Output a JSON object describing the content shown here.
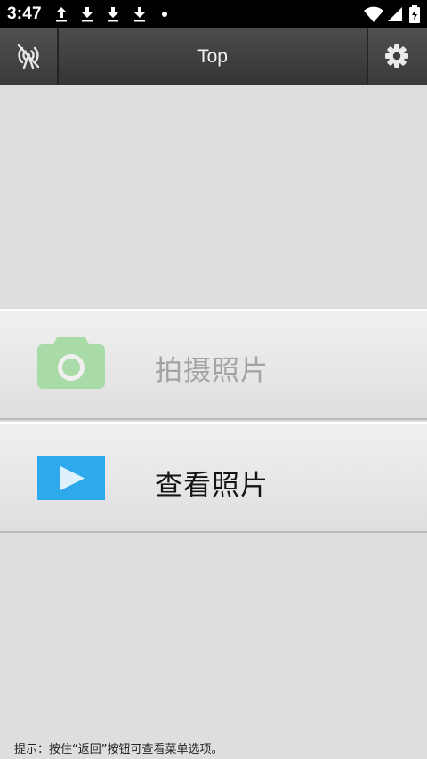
{
  "status_bar": {
    "time": "3:47",
    "icons": [
      "upload-icon",
      "download-icon",
      "download-icon",
      "download-icon",
      "notification-dot-icon",
      "wifi-icon",
      "signal-icon",
      "battery-icon"
    ]
  },
  "toolbar": {
    "title": "Top",
    "left_icon": "no-signal-antenna-icon",
    "right_icon": "gear-icon"
  },
  "menu": {
    "items": [
      {
        "label": "拍摄照片",
        "icon": "camera-icon",
        "enabled": false,
        "icon_color": "#a8dba8"
      },
      {
        "label": "查看照片",
        "icon": "play-icon",
        "enabled": true,
        "icon_color": "#2eaaec"
      }
    ]
  },
  "hint": "提示：按住“返回”按钮可查看菜单选项。",
  "colors": {
    "background": "#dedede",
    "toolbar": "#3f3f3f",
    "status_bar": "#000000"
  }
}
